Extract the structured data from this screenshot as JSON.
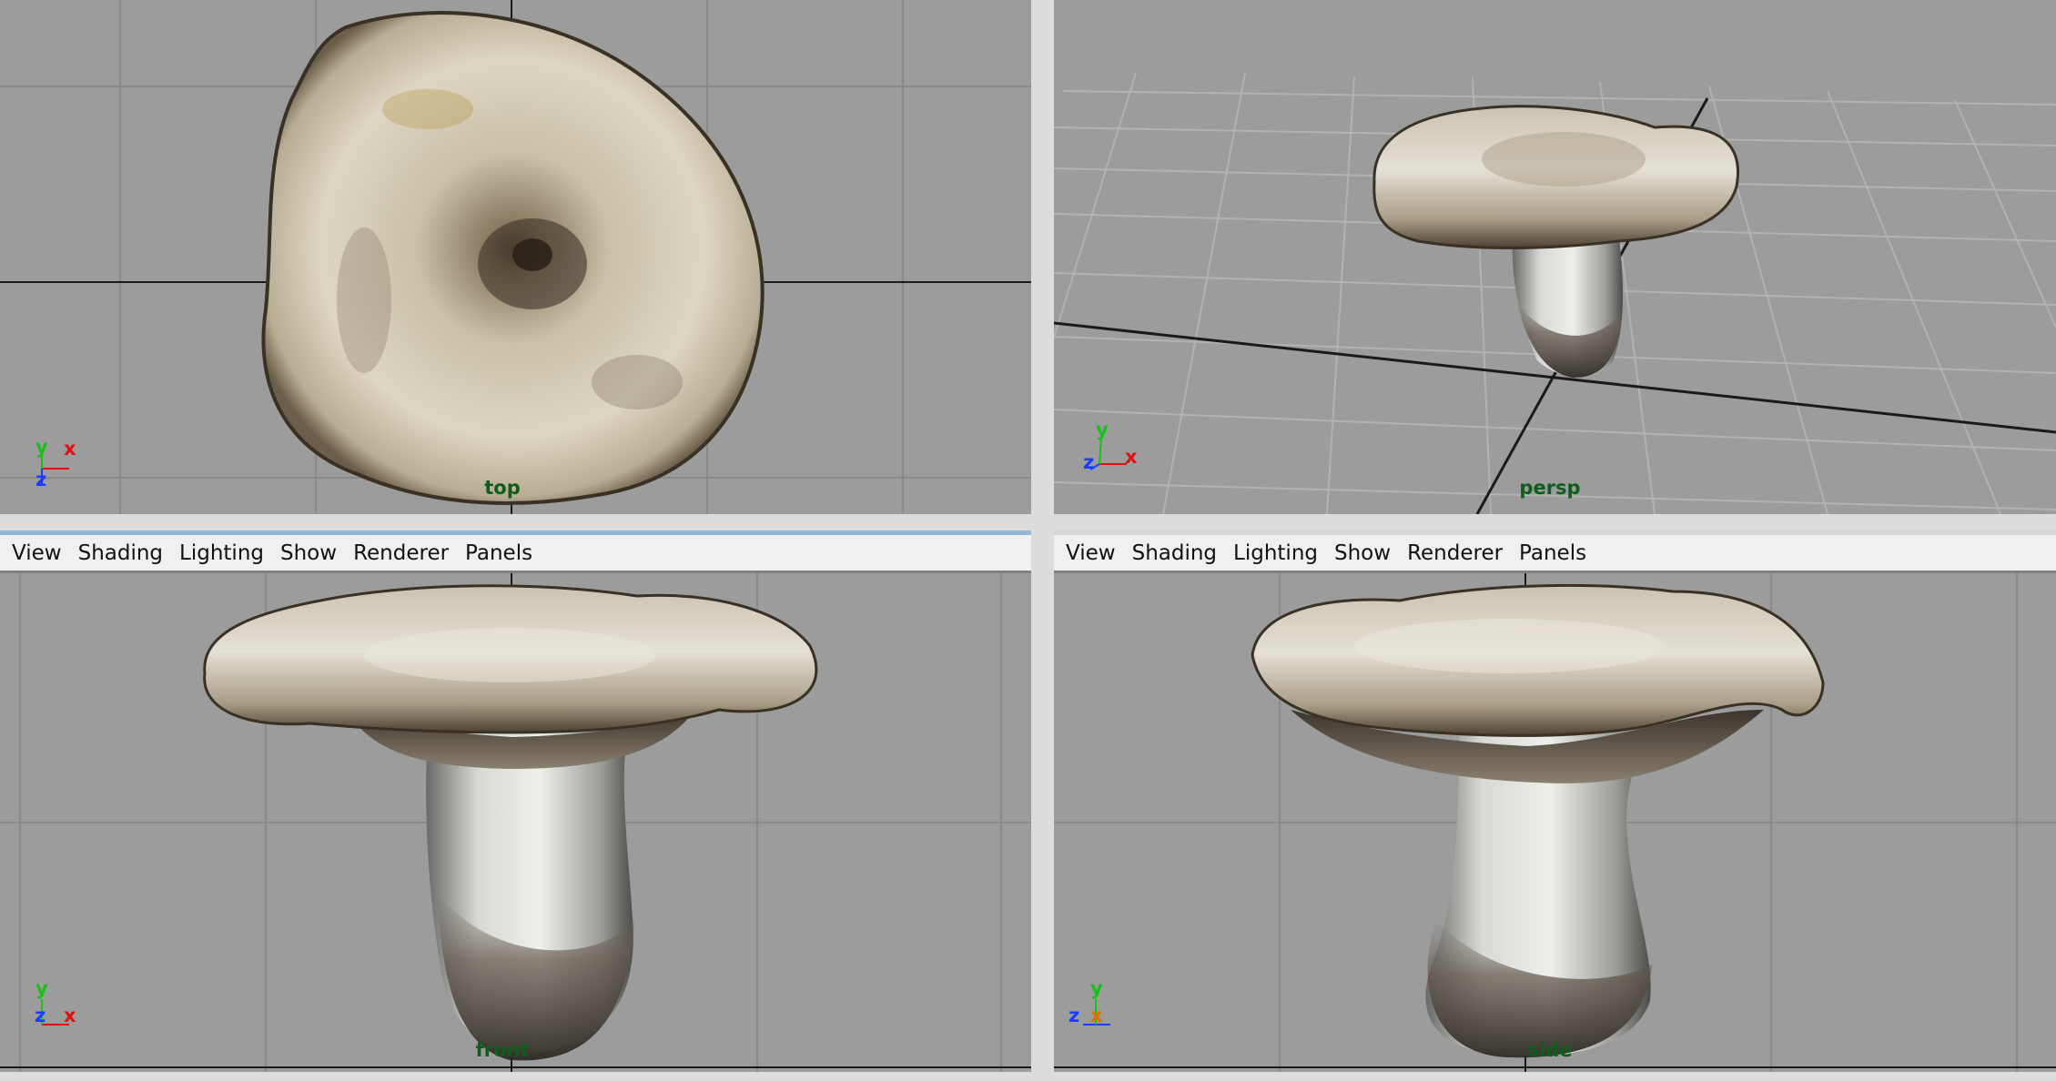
{
  "viewports": {
    "top": {
      "camera": "top"
    },
    "persp": {
      "camera": "persp"
    },
    "front": {
      "camera": "front"
    },
    "side": {
      "camera": "side"
    }
  },
  "menus": {
    "front": [
      "View",
      "Shading",
      "Lighting",
      "Show",
      "Renderer",
      "Panels"
    ],
    "side": [
      "View",
      "Shading",
      "Lighting",
      "Show",
      "Renderer",
      "Panels"
    ]
  },
  "axis_labels": {
    "x": "x",
    "y": "y",
    "z": "z"
  },
  "colors": {
    "viewport_bg": "#9c9c9c",
    "grid": "#8a8a8a",
    "grid_axis": "#1a1a1a",
    "label": "#0f5c1e",
    "axis_x": "#e01010",
    "axis_y": "#18c018",
    "axis_z": "#1a3cff",
    "axis_x_side": "#e07000"
  }
}
